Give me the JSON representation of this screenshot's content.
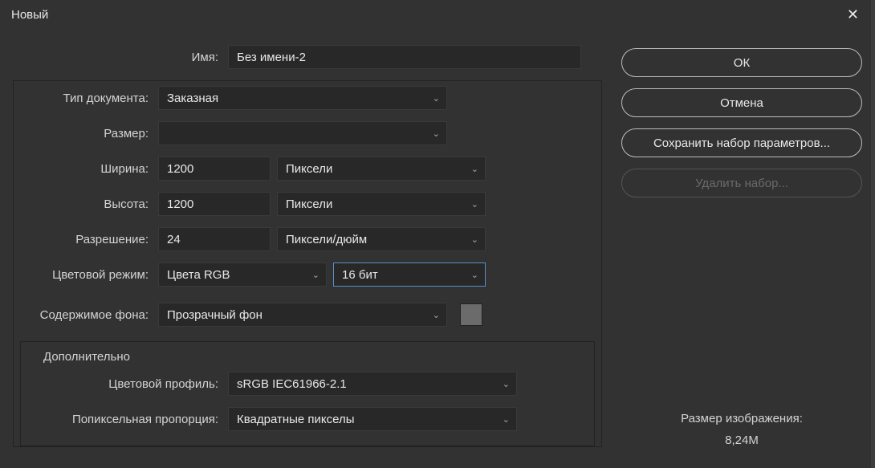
{
  "title": "Новый",
  "labels": {
    "name": "Имя:",
    "doc_type": "Тип документа:",
    "size": "Размер:",
    "width": "Ширина:",
    "height": "Высота:",
    "resolution": "Разрешение:",
    "color_mode": "Цветовой режим:",
    "bg_content": "Содержимое фона:",
    "advanced": "Дополнительно",
    "color_profile": "Цветовой профиль:",
    "pixel_aspect": "Попиксельная пропорция:"
  },
  "values": {
    "name": "Без имени-2",
    "doc_type": "Заказная",
    "size": "",
    "width": "1200",
    "width_unit": "Пиксели",
    "height": "1200",
    "height_unit": "Пиксели",
    "resolution": "24",
    "resolution_unit": "Пиксели/дюйм",
    "color_mode": "Цвета RGB",
    "bits": "16 бит",
    "bg_content": "Прозрачный фон",
    "color_profile": "sRGB IEC61966-2.1",
    "pixel_aspect": "Квадратные пикселы"
  },
  "buttons": {
    "ok": "ОК",
    "cancel": "Отмена",
    "save_preset": "Сохранить набор параметров...",
    "delete_preset": "Удалить набор..."
  },
  "image_size": {
    "label": "Размер изображения:",
    "value": "8,24M"
  }
}
